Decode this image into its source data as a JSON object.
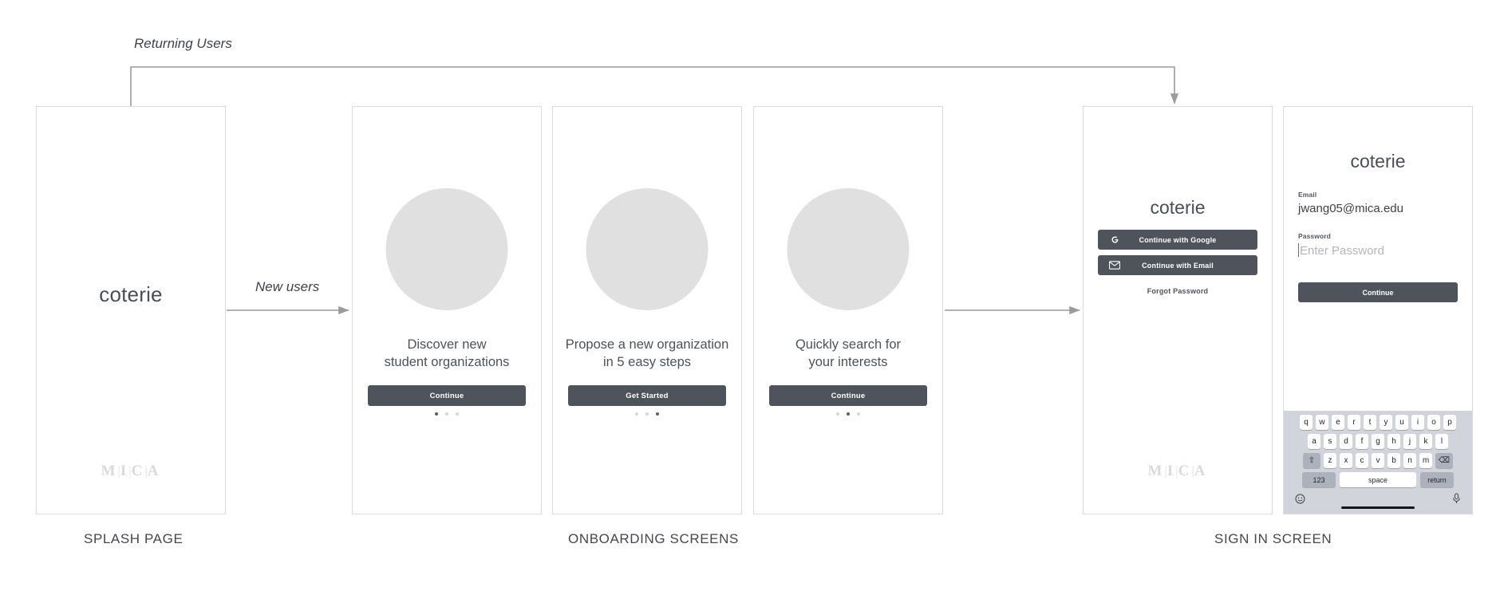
{
  "flow": {
    "returning_label": "Returning Users",
    "new_users_label": "New users"
  },
  "captions": {
    "splash": "SPLASH PAGE",
    "onboarding": "ONBOARDING SCREENS",
    "signin": "SIGN IN SCREEN"
  },
  "brand": {
    "wordmark": "coterie",
    "mica": {
      "m": "M",
      "i": "I",
      "c": "C",
      "a": "A",
      "bar": "|"
    },
    "accent_dark": "#4e535c",
    "circle_gray": "#e0e0e0",
    "frame_border": "#dcdcdc",
    "text_gray": "#4e5257"
  },
  "splash": {
    "wordmark": "coterie"
  },
  "onboarding": [
    {
      "line1": "Discover new",
      "line2": "student organizations",
      "button": "Continue",
      "active_dot": 0,
      "dot_count": 3
    },
    {
      "line1": "Propose a new organization",
      "line2": "in 5 easy steps",
      "button": "Get Started",
      "active_dot": 2,
      "dot_count": 3
    },
    {
      "line1": "Quickly search for",
      "line2": "your interests",
      "button": "Continue",
      "active_dot": 1,
      "dot_count": 3
    }
  ],
  "signin": {
    "wordmark": "coterie",
    "google_button": "Continue with Google",
    "google_icon": "G",
    "email_button": "Continue with Email",
    "email_icon": "✉",
    "forgot_link": "Forgot Password"
  },
  "email_screen": {
    "wordmark": "coterie",
    "email_label": "Email",
    "email_value": "jwang05@mica.edu",
    "password_label": "Password",
    "password_placeholder": "Enter Password",
    "continue_button": "Continue"
  },
  "keyboard": {
    "row1": [
      "q",
      "w",
      "e",
      "r",
      "t",
      "y",
      "u",
      "i",
      "o",
      "p"
    ],
    "row2": [
      "a",
      "s",
      "d",
      "f",
      "g",
      "h",
      "j",
      "k",
      "l"
    ],
    "row3": [
      "z",
      "x",
      "c",
      "v",
      "b",
      "n",
      "m"
    ],
    "shift_key": "⇧",
    "backspace_key": "⌫",
    "numbers_key": "123",
    "space_key": "space",
    "return_key": "return",
    "emoji_key": "☺",
    "mic_key": "\u0001"
  }
}
